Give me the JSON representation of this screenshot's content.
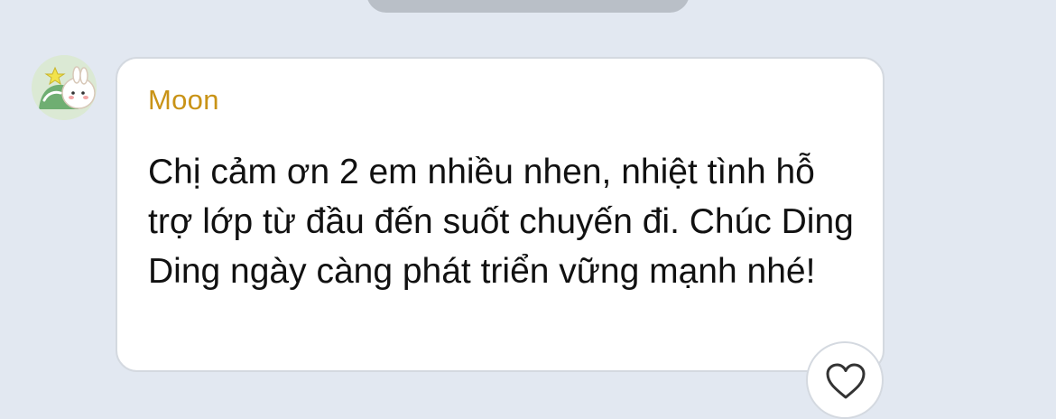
{
  "message": {
    "sender": "Moon",
    "text": "Chị cảm ơn 2 em nhiều nhen, nhiệt tình hỗ trợ lớp từ đầu đến suốt chuyến đi. Chúc Ding Ding ngày càng phát triển vững mạnh nhé!"
  },
  "icons": {
    "avatar": "avatar-image",
    "reaction": "heart-icon"
  },
  "colors": {
    "background": "#e2e8f1",
    "sender_name": "#c99316",
    "bubble": "#ffffff"
  }
}
